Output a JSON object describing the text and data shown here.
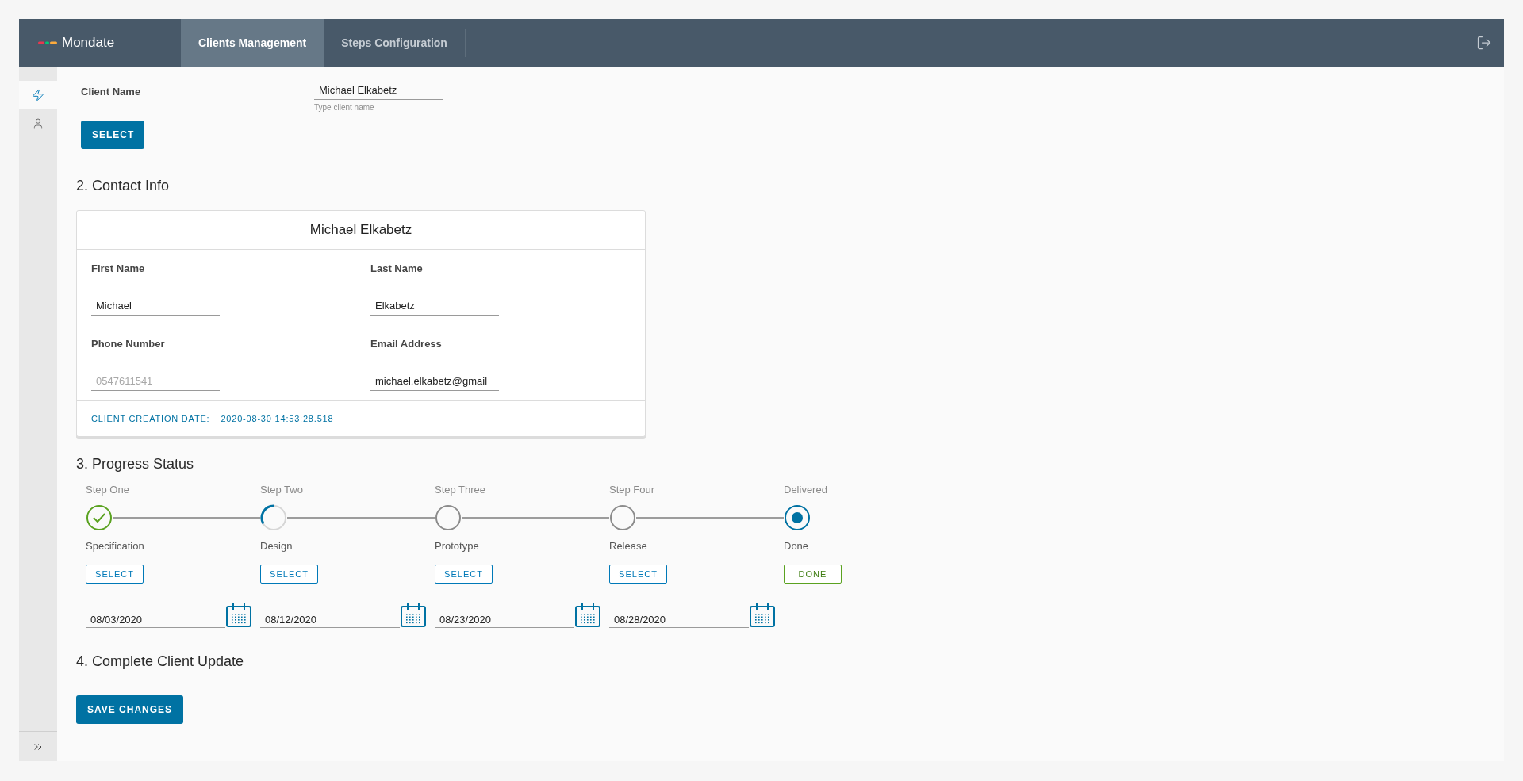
{
  "header": {
    "logo_text": "Mondate",
    "tabs": [
      {
        "label": "Clients Management",
        "selected": true
      },
      {
        "label": "Steps Configuration",
        "selected": false
      }
    ]
  },
  "sidebar": {
    "items": [
      {
        "kind": "bolt",
        "selected": true
      },
      {
        "kind": "user",
        "selected": false
      }
    ]
  },
  "client_select": {
    "label": "Client Name",
    "value": "Michael Elkabetz",
    "helper_text": "Type client name",
    "button": "SELECT"
  },
  "contact": {
    "heading": "2. Contact Info",
    "card_title": "Michael Elkabetz",
    "fields": [
      {
        "label": "First Name",
        "value": "Michael"
      },
      {
        "label": "Last Name",
        "value": "Elkabetz"
      },
      {
        "label": "Phone Number",
        "placeholder": "0547611541"
      },
      {
        "label": "Email Address",
        "value": "michael.elkabetz@gmail"
      }
    ],
    "footer_label": "CLIENT CREATION DATE:",
    "footer_value": "2020-08-30 14:53:28.518"
  },
  "progress": {
    "heading": "3. Progress Status",
    "steps": [
      {
        "title": "Step One",
        "kind": "complete",
        "name": "Specification",
        "action": {
          "label": "SELECT",
          "kind": "select"
        },
        "date": "08/03/2020"
      },
      {
        "title": "Step Two",
        "kind": "partial",
        "name": "Design",
        "action": {
          "label": "SELECT",
          "kind": "select"
        },
        "date": "08/12/2020"
      },
      {
        "title": "Step Three",
        "kind": "empty",
        "name": "Prototype",
        "action": {
          "label": "SELECT",
          "kind": "select"
        },
        "date": "08/23/2020"
      },
      {
        "title": "Step Four",
        "kind": "empty",
        "name": "Release",
        "action": {
          "label": "SELECT",
          "kind": "select"
        },
        "date": "08/28/2020"
      },
      {
        "title": "Delivered",
        "kind": "current",
        "name": "Done",
        "action": {
          "label": "DONE",
          "kind": "done"
        }
      }
    ]
  },
  "update": {
    "heading": "4. Complete Client Update",
    "button": "SAVE CHANGES"
  }
}
